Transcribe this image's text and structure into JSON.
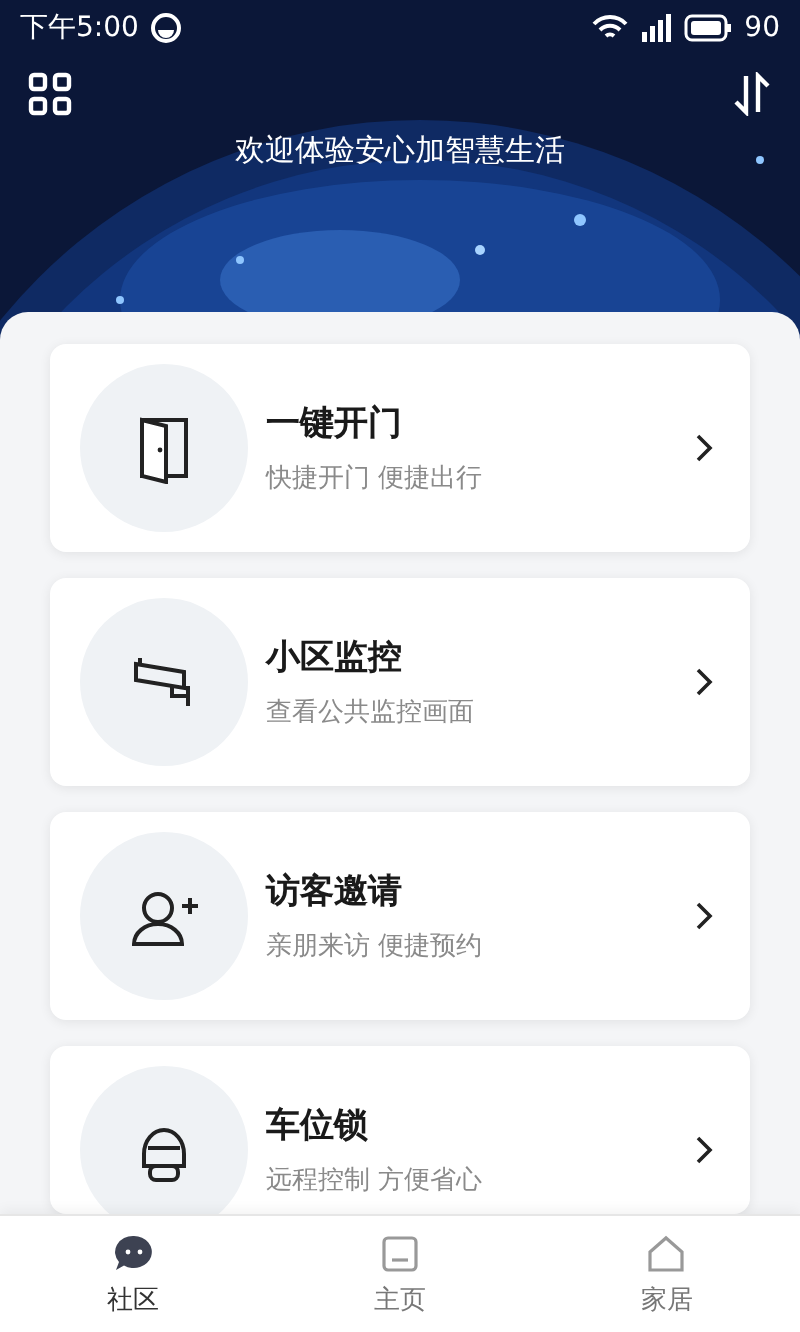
{
  "status_bar": {
    "time": "下午5:00",
    "battery": "90"
  },
  "header": {
    "kind": "picture",
    "greeting": "欢迎体验安心加智慧生活"
  },
  "cards": [
    {
      "kind": "door",
      "title": "一键开门",
      "subtitle": "快捷开门 便捷出行"
    },
    {
      "kind": "camera",
      "title": "小区监控",
      "subtitle": "查看公共监控画面"
    },
    {
      "kind": "visitor",
      "title": "访客邀请",
      "subtitle": "亲朋来访 便捷预约"
    },
    {
      "kind": "lock",
      "title": "车位锁",
      "subtitle": "远程控制 方便省心"
    }
  ],
  "nav": [
    {
      "kind": "chat",
      "label": "社区",
      "selected": true
    },
    {
      "kind": "home",
      "label": "主页",
      "selected": false
    },
    {
      "kind": "house",
      "label": "家居",
      "selected": false
    }
  ]
}
